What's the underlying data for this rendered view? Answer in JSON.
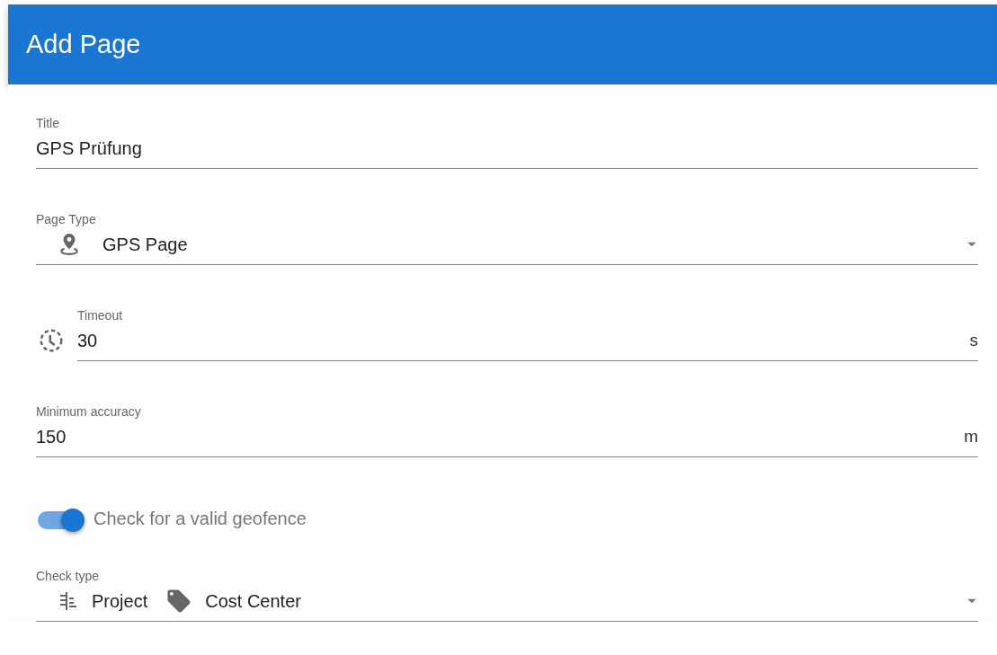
{
  "header": {
    "title": "Add Page"
  },
  "fields": [
    {
      "kind": "text",
      "label": "Title",
      "value": "GPS Prüfung"
    },
    {
      "kind": "select",
      "label": "Page Type",
      "value": "GPS Page"
    },
    {
      "kind": "number-with-icon",
      "label": "Timeout",
      "value": "30",
      "suffix": "s"
    },
    {
      "kind": "number",
      "label": "Minimum accuracy",
      "value": "150",
      "suffix": "m"
    },
    {
      "kind": "switch",
      "label": "Check for a valid geofence",
      "on": true
    },
    {
      "kind": "multiselect",
      "label": "Check type",
      "chips": [
        "Project",
        "Cost Center"
      ]
    }
  ]
}
